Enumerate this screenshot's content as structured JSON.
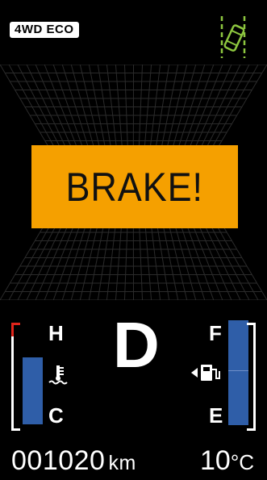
{
  "header": {
    "drive_mode": "4WD ECO",
    "assist_icon": "lane-departure-car-icon"
  },
  "alert": {
    "text": "BRAKE!",
    "color": "#f5a000"
  },
  "temperature_gauge": {
    "high_label": "H",
    "low_label": "C",
    "icon": "coolant-temperature-icon",
    "level": 0.65
  },
  "gear": {
    "position": "D"
  },
  "fuel_gauge": {
    "full_label": "F",
    "empty_label": "E",
    "icon": "fuel-pump-icon",
    "level": 1.0
  },
  "odometer": {
    "value": "001020",
    "unit": "km"
  },
  "outside_temp": {
    "value": "10",
    "unit": "°C"
  },
  "colors": {
    "gauge_fill": "#2f5ea8",
    "warning_red": "#e1251b",
    "assist_green": "#8dc63f"
  }
}
